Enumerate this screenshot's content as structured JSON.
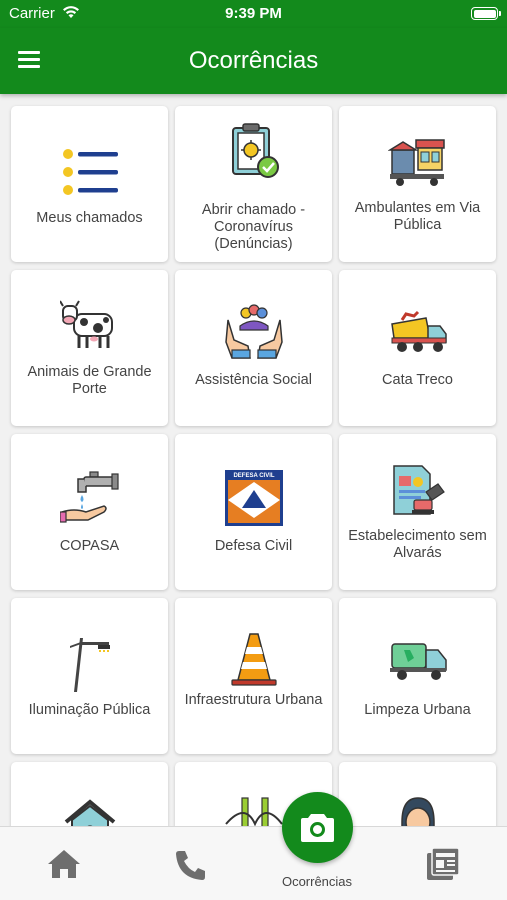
{
  "status_bar": {
    "carrier": "Carrier",
    "time": "9:39 PM"
  },
  "app_bar": {
    "title": "Ocorrências"
  },
  "cards": [
    {
      "label": "Meus chamados",
      "icon": "list-icon"
    },
    {
      "label": "Abrir chamado - Coronavírus (Denúncias)",
      "icon": "clipboard-virus-icon"
    },
    {
      "label": "Ambulantes em Via Pública",
      "icon": "street-vendor-icon"
    },
    {
      "label": "Animais de Grande Porte",
      "icon": "cow-icon"
    },
    {
      "label": "Assistência Social",
      "icon": "hands-people-icon"
    },
    {
      "label": "Cata Treco",
      "icon": "dump-truck-icon"
    },
    {
      "label": "COPASA",
      "icon": "water-tap-icon"
    },
    {
      "label": "Defesa Civil",
      "icon": "civil-defense-logo-icon"
    },
    {
      "label": "Estabelecimento sem Alvarás",
      "icon": "stamp-document-icon"
    },
    {
      "label": "Iluminação Pública",
      "icon": "street-light-icon"
    },
    {
      "label": "Infraestrutura Urbana",
      "icon": "traffic-cone-icon"
    },
    {
      "label": "Limpeza Urbana",
      "icon": "garbage-truck-icon"
    },
    {
      "label": "",
      "icon": "house-icon"
    },
    {
      "label": "",
      "icon": "bridge-icon"
    },
    {
      "label": "",
      "icon": "person-icon"
    }
  ],
  "bottom_nav": {
    "home_icon": "home-icon",
    "phone_icon": "phone-icon",
    "camera_icon": "camera-icon",
    "active_label": "Ocorrências",
    "news_icon": "news-icon"
  },
  "colors": {
    "primary": "#138a1c",
    "background": "#f1f1f1",
    "icon_navy": "#1f3f8f",
    "icon_yellow": "#f3c623"
  }
}
